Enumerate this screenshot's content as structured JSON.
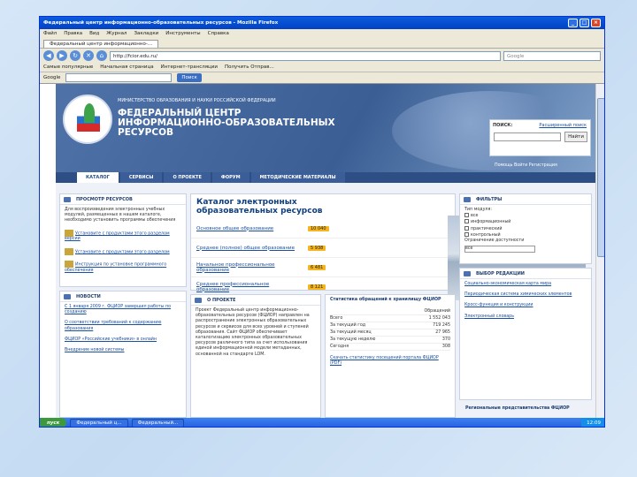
{
  "window": {
    "title": "Федеральный центр информационно-образовательных ресурсов - Mozilla Firefox"
  },
  "menu": [
    "Файл",
    "Правка",
    "Вид",
    "Журнал",
    "Закладки",
    "Инструменты",
    "Справка"
  ],
  "tab": {
    "label": "Федеральный центр информационно-..."
  },
  "nav": {
    "address": "http://fcior.edu.ru/",
    "search_label": "Google",
    "nav_buttons": [
      "back-icon",
      "forward-icon",
      "reload-icon",
      "stop-icon",
      "home-icon"
    ]
  },
  "bookmarks": [
    "Самые популярные",
    "Начальная страница",
    "Интернет-трансляции",
    "Получить Отправ..."
  ],
  "google_bar": {
    "brand": "Google",
    "button": "Поиск"
  },
  "site": {
    "ministry": "МИНИСТЕРСТВО ОБРАЗОВАНИЯ И НАУКИ РОССИЙСКОЙ ФЕДЕРАЦИИ",
    "center_lines": [
      "ФЕДЕРАЛЬНЫЙ ЦЕНТР",
      "ИНФОРМАЦИОННО-ОБРАЗОВАТЕЛЬНЫХ",
      "РЕСУРСОВ"
    ],
    "search": {
      "label": "ПОИСК:",
      "advanced": "Расширенный поиск",
      "button": "Найти"
    },
    "help": "Помощь  Войти  Регистрация",
    "nav": [
      "КАТАЛОГ",
      "СЕРВИСЫ",
      "О ПРОЕКТЕ",
      "ФОРУМ",
      "МЕТОДИЧЕСКИЕ МАТЕРИАЛЫ"
    ],
    "view_panel": {
      "header": "ПРОСМОТР РЕСУРСОВ",
      "text": "Для воспроизведения электронных учебных модулей, размещенных в нашем каталоге, необходимо установить программы обеспечения",
      "items": [
        "Установите с продуктами этого разделом версии",
        "Установите с продуктами этого разделом",
        "Инструкция по установке программного обеспечения"
      ]
    },
    "news_panel": {
      "header": "НОВОСТИ",
      "items": [
        "С 1 января 2009 г. ФЦИОР завершил работы по созданию",
        "О соответствии требований к содержанию образования",
        "ФЦИОР «Российские учебники» в онлайн",
        "Внедрение новой системы"
      ]
    },
    "catalog": {
      "title": "Каталог электронных образовательных ресурсов",
      "rows": [
        {
          "label": "Основное общее образование",
          "count": "10 040"
        },
        {
          "label": "Среднее (полное) общее образование",
          "count": "5 938"
        },
        {
          "label": "Начальное профессиональное образование",
          "count": "6 481"
        },
        {
          "label": "Среднее профессиональное образование",
          "count": "8 121"
        }
      ]
    },
    "about": {
      "header": "О ПРОЕКТЕ",
      "text": "Проект Федеральный центр информационно-образовательных ресурсов (ФЦИОР) направлен на распространение электронных образовательных ресурсов и сервисов для всех уровней и ступеней образования. Сайт ФЦИОР обеспечивает каталогизацию электронных образовательных ресурсов различного типа за счет использования единой информационной модели метаданных, основанной на стандарте LOM."
    },
    "stats": {
      "header": "Статистика обращений к хранилищу ФЦИОР",
      "col": "Обращений",
      "rows": [
        [
          "Всего",
          "1 552 043"
        ],
        [
          "За текущий год",
          "719 245"
        ],
        [
          "За текущий месяц",
          "27 965"
        ],
        [
          "За текущую неделю",
          "370"
        ],
        [
          "Сегодня",
          "308"
        ]
      ],
      "link": "Скачать статистику посещений портала ФЦИОР (PDF)"
    },
    "filters": {
      "header": "ФИЛЬТРЫ",
      "type_label": "Тип модуля:",
      "types": [
        "все",
        "информационный",
        "практический",
        "контрольный"
      ],
      "age_label": "Ограничение доступности",
      "age_value": "все"
    },
    "editor": {
      "header": "ВЫБОР РЕДАКЦИИ",
      "items": [
        "Социально-экономическая карта мира",
        "Периодическая система химических элементов",
        "Кросс-функция и конструкции",
        "Электронный словарь"
      ]
    },
    "regional": "Региональные представительства ФЦИОР"
  },
  "taskbar": {
    "start": "пуск",
    "items": [
      "Федеральный ц...",
      "Федеральный..."
    ],
    "clock": "12:09"
  }
}
